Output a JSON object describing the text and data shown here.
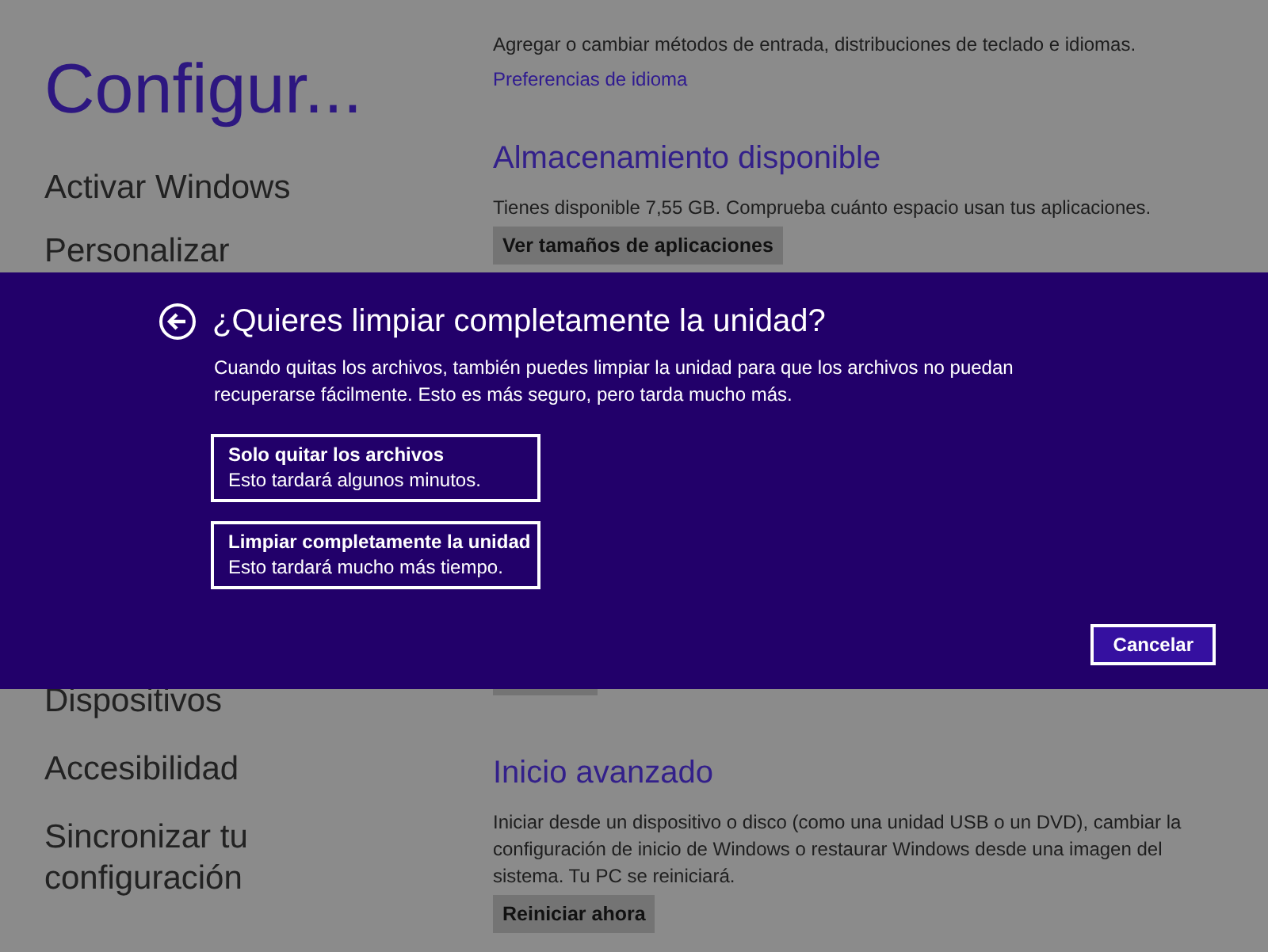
{
  "sidebar": {
    "title": "Configur...",
    "items": [
      {
        "label": "Activar Windows"
      },
      {
        "label": "Personalizar"
      },
      {
        "label": "Dispositivos"
      },
      {
        "label": "Accesibilidad"
      },
      {
        "label": "Sincronizar tu configuración"
      }
    ]
  },
  "sections": [
    {
      "description": "Agregar o cambiar métodos de entrada, distribuciones de teclado e idiomas.",
      "link": "Preferencias de idioma"
    },
    {
      "heading": "Almacenamiento disponible",
      "description": "Tienes disponible 7,55 GB. Comprueba cuánto espacio usan tus aplicaciones.",
      "button": "Ver tamaños de aplicaciones"
    },
    {
      "heading": "Inicio avanzado",
      "description": "Iniciar desde un dispositivo o disco (como una unidad USB o un DVD), cambiar la configuración de inicio de Windows o restaurar Windows desde una imagen del sistema. Tu PC se reiniciará.",
      "button": "Reiniciar ahora"
    }
  ],
  "dialog": {
    "title": "¿Quieres limpiar completamente la unidad?",
    "description": "Cuando quitas los archivos, también puedes limpiar la unidad para que los archivos no puedan recuperarse fácilmente. Esto es más seguro, pero tarda mucho más.",
    "options": [
      {
        "title": "Solo quitar los archivos",
        "detail": "Esto tardará algunos minutos."
      },
      {
        "title": "Limpiar completamente la unidad",
        "detail": "Esto tardará mucho más tiempo."
      }
    ],
    "cancel": "Cancelar"
  }
}
